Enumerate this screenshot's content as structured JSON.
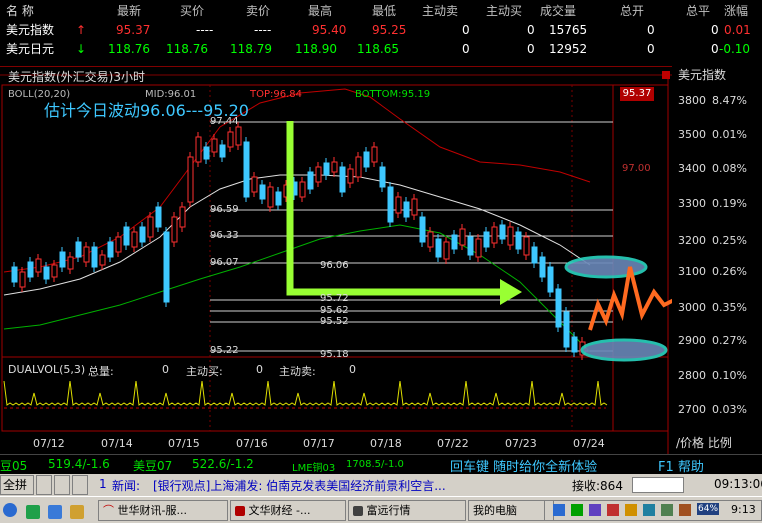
{
  "header": [
    "名 称",
    "最新",
    "买价",
    "卖价",
    "最高",
    "最低",
    "主动卖",
    "主动买",
    "成交量",
    "总开",
    "总平",
    "涨幅"
  ],
  "rows": [
    {
      "name": "美元指数",
      "arrow": "↑",
      "arrow_color": "#ff3030",
      "latest": "95.37",
      "bid": "----",
      "ask": "----",
      "high": "95.40",
      "low": "95.25",
      "active_sell": "0",
      "active_buy": "0",
      "volume": "15765",
      "open_total": "0",
      "close_total": "0",
      "change": "0.01"
    },
    {
      "name": "美元日元",
      "arrow": "↓",
      "arrow_color": "#00ff00",
      "latest": "118.76",
      "bid": "118.76",
      "ask": "118.79",
      "high": "118.90",
      "low": "118.65",
      "active_sell": "0",
      "active_buy": "0",
      "volume": "12952",
      "open_total": "0",
      "close_total": "0",
      "change": "-0.10"
    }
  ],
  "chart": {
    "title": "美元指数(外汇交易)3小时",
    "boll_label": "BOLL(20,20)",
    "mid_label": "MID:96.01",
    "top_label": "TOP:96.84",
    "bottom_label": "BOTTOM:95.19",
    "estimate": "估计今日波动96.06---95.20",
    "price_box": "95.37",
    "price_marks": [
      "97.44",
      "96.59",
      "96.33",
      "96.07",
      "95.22"
    ],
    "right_mark": "97.00",
    "mid_marks": [
      "96.06",
      "95.72",
      "95.62",
      "95.52",
      "95.18"
    ],
    "dual_label": "DUALVOL(5,3)",
    "total_label": "总量:",
    "total_value": "0",
    "sell_label": "主动买:",
    "sell_value": "0",
    "buy_label": "主动卖:",
    "buy_value": "0",
    "x_dates": [
      "07/12",
      "07/14",
      "07/15",
      "07/16",
      "07/17",
      "07/18",
      "07/22",
      "07/23",
      "07/24"
    ]
  },
  "right_panel": {
    "title": "美元指数",
    "scale": [
      {
        "left": "3800",
        "right": "8.47%"
      },
      {
        "left": "3500",
        "right": "0.01%"
      },
      {
        "left": "3400",
        "right": "0.08%"
      },
      {
        "left": "3300",
        "right": "0.19%"
      },
      {
        "left": "3200",
        "right": "0.25%"
      },
      {
        "left": "3100",
        "right": "0.26%"
      },
      {
        "left": "3000",
        "right": "0.35%"
      },
      {
        "left": "2900",
        "right": "0.27%"
      },
      {
        "left": "2800",
        "right": "0.10%"
      },
      {
        "left": "2700",
        "right": "0.03%"
      }
    ],
    "footer": "/价格 比例"
  },
  "ticker": [
    {
      "label": "豆05",
      "value": "519.4/-1.6"
    },
    {
      "label": "美豆07",
      "value": "522.6/-1.2"
    },
    {
      "label": "LME铜03",
      "value": "1708.5/-1.0"
    }
  ],
  "promo": "回车键 随时给你全新体验",
  "help": "F1 帮助",
  "news_bar": {
    "btn": "全拼",
    "news_index": "1",
    "news_label": "新闻:",
    "news_text": "[银行观点]上海浦发: 伯南克发表美国经济前景利空言...",
    "recv_label": "接收:864",
    "time": "09:13:06"
  },
  "taskbar": {
    "items": [
      "世华财讯-服...",
      "文华财经 -...",
      "富远行情",
      "我的电脑"
    ],
    "clock": "9:13",
    "tray_pct": "64%"
  }
}
